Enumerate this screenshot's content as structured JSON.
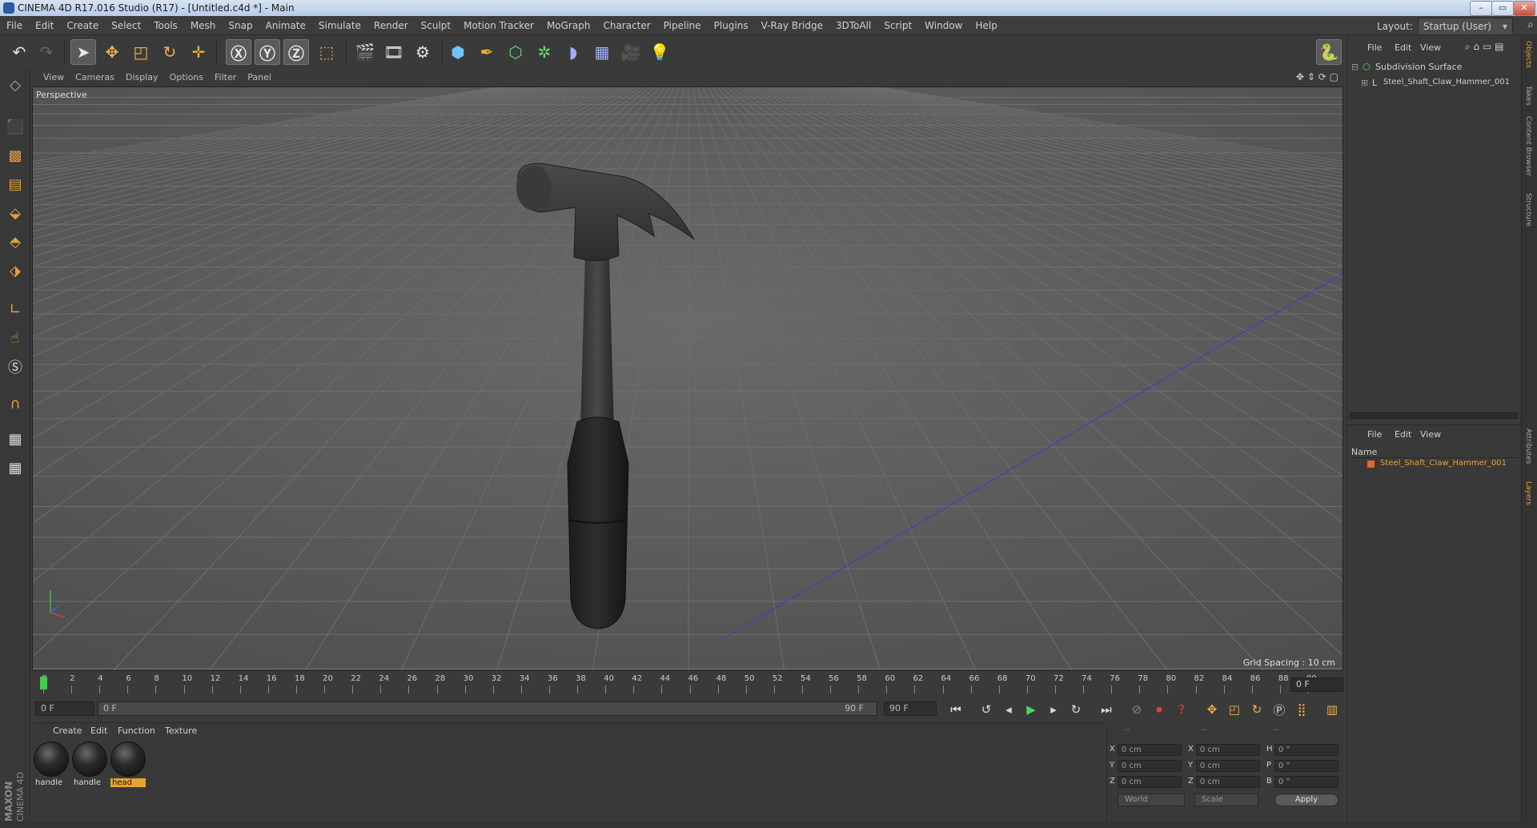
{
  "window": {
    "title": "CINEMA 4D R17.016 Studio (R17) - [Untitled.c4d *] - Main",
    "controls": [
      "–",
      "▭",
      "✕"
    ]
  },
  "menubar": {
    "items": [
      "File",
      "Edit",
      "Create",
      "Select",
      "Tools",
      "Mesh",
      "Snap",
      "Animate",
      "Simulate",
      "Render",
      "Sculpt",
      "Motion Tracker",
      "MoGraph",
      "Character",
      "Pipeline",
      "Plugins",
      "V-Ray Bridge",
      "3DToAll",
      "Script",
      "Window",
      "Help"
    ],
    "layout_label": "Layout:",
    "layout_value": "Startup (User)"
  },
  "toolbar": {
    "icons": [
      "undo-icon",
      "redo-icon",
      "select-cursor-icon",
      "move-icon",
      "scale-icon",
      "rotate-icon",
      "live-transform-icon",
      "x-axis-icon",
      "y-axis-icon",
      "z-axis-icon",
      "coordinate-system-icon",
      "render-view-icon",
      "render-picture-viewer-icon",
      "render-settings-icon",
      "cube-icon",
      "pen-spline-icon",
      "subdivision-icon",
      "array-icon",
      "deformer-icon",
      "floor-icon",
      "camera-icon",
      "light-icon",
      "python-icon"
    ]
  },
  "viewport": {
    "menu": [
      "View",
      "Cameras",
      "Display",
      "Options",
      "Filter",
      "Panel"
    ],
    "camera_label": "Perspective",
    "grid_spacing": "Grid Spacing : 10 cm"
  },
  "timeline": {
    "ticks": [
      "0",
      "2",
      "4",
      "6",
      "8",
      "10",
      "12",
      "14",
      "16",
      "18",
      "20",
      "22",
      "24",
      "26",
      "28",
      "30",
      "32",
      "34",
      "36",
      "38",
      "40",
      "42",
      "44",
      "46",
      "48",
      "50",
      "52",
      "54",
      "56",
      "58",
      "60",
      "62",
      "64",
      "66",
      "68",
      "70",
      "72",
      "74",
      "76",
      "78",
      "80",
      "82",
      "84",
      "86",
      "88",
      "90"
    ],
    "current_frame": "0 F"
  },
  "transport": {
    "start_field": "0 F",
    "range_start": "0 F",
    "range_end": "90 F",
    "end_field": "90 F"
  },
  "materials": {
    "menu": [
      "Create",
      "Edit",
      "Function",
      "Texture"
    ],
    "items": [
      {
        "label": "handle",
        "selected": false
      },
      {
        "label": "handle",
        "selected": false
      },
      {
        "label": "head",
        "selected": true
      }
    ]
  },
  "coordinates": {
    "header": [
      "--",
      "--",
      "--"
    ],
    "rows": [
      {
        "a": "X",
        "av": "0 cm",
        "b": "X",
        "bv": "0 cm",
        "c": "H",
        "cv": "0 °"
      },
      {
        "a": "Y",
        "av": "0 cm",
        "b": "Y",
        "bv": "0 cm",
        "c": "P",
        "cv": "0 °"
      },
      {
        "a": "Z",
        "av": "0 cm",
        "b": "Z",
        "bv": "0 cm",
        "c": "B",
        "cv": "0 °"
      }
    ],
    "space": "World",
    "mode": "Scale",
    "apply": "Apply"
  },
  "objects": {
    "menu": [
      "File",
      "Edit",
      "View"
    ],
    "tree": [
      "Subdivision Surface",
      "Steel_Shaft_Claw_Hammer_001"
    ]
  },
  "layers": {
    "menu": [
      "File",
      "Edit",
      "View"
    ],
    "column": "Name",
    "items": [
      "Steel_Shaft_Claw_Hammer_001"
    ]
  },
  "side_tabs": [
    "Objects",
    "Takes",
    "Content Browser",
    "Structure",
    "Attributes",
    "Layers"
  ],
  "brand": {
    "line1": "MAXON",
    "line2": "CINEMA 4D"
  },
  "colors": {
    "accent": "#e8a32c",
    "viewport_bg": "#5e5e5e",
    "selected_text": "#e8a32c"
  }
}
